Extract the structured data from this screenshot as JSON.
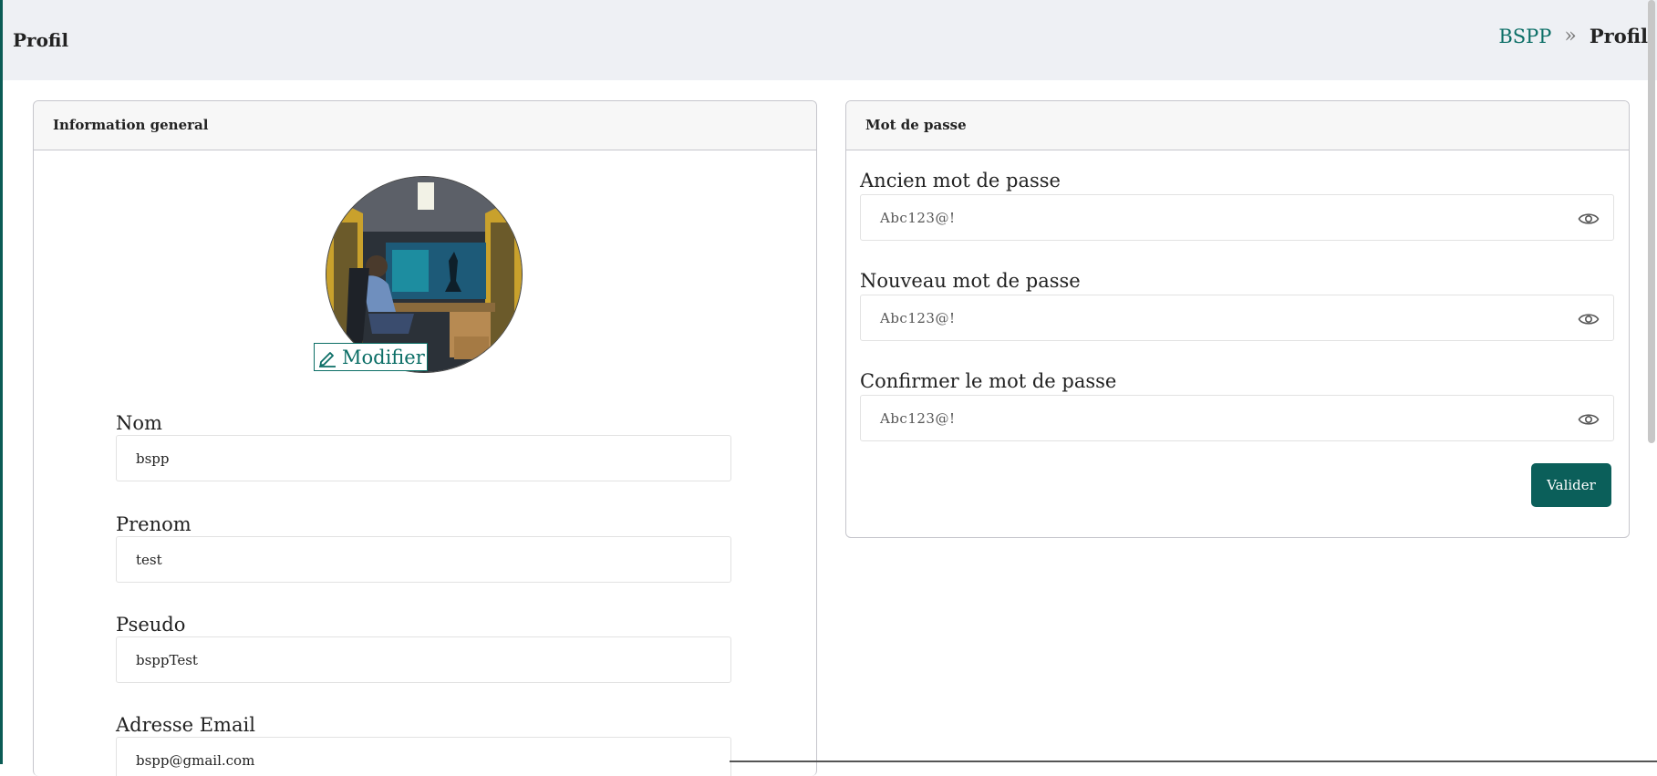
{
  "header": {
    "title": "Profil",
    "breadcrumb": {
      "link": "BSPP",
      "separator": "»",
      "current": "Profil"
    }
  },
  "general_card": {
    "title": "Information general",
    "edit_label": "Modifier",
    "fields": [
      {
        "label": "Nom",
        "value": "bspp"
      },
      {
        "label": "Prenom",
        "value": "test"
      },
      {
        "label": "Pseudo",
        "value": "bsppTest"
      },
      {
        "label": "Adresse Email",
        "value": "bspp@gmail.com"
      }
    ]
  },
  "password_card": {
    "title": "Mot de passe",
    "fields": [
      {
        "label": "Ancien mot de passe",
        "placeholder": "Abc123@!"
      },
      {
        "label": "Nouveau mot de passe",
        "placeholder": "Abc123@!"
      },
      {
        "label": "Confirmer le mot de passe",
        "placeholder": "Abc123@!"
      }
    ],
    "submit_label": "Valider"
  },
  "colors": {
    "accent": "#0b6e66",
    "button": "#0b5f5a",
    "topbar": "#eef0f4"
  },
  "icons": {
    "edit": "pencil-icon",
    "visibility": "eye-icon",
    "breadcrumb": "double-chevron-icon"
  }
}
